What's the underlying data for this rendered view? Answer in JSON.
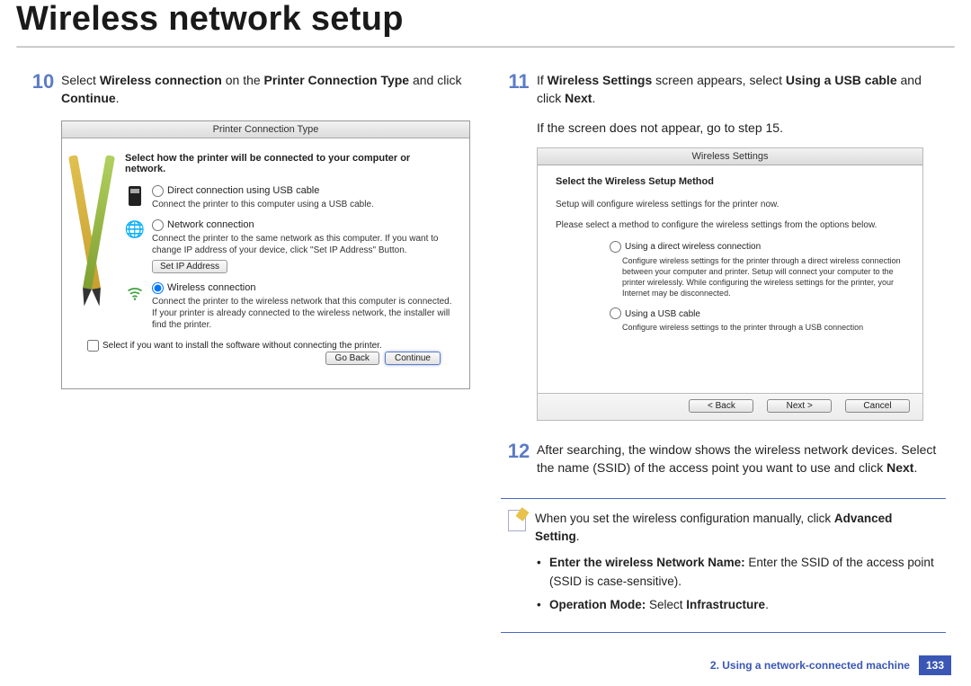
{
  "title": "Wireless network setup",
  "left": {
    "stepNum": "10",
    "stepText": "Select <b>Wireless connection</b> on the <b>Printer Connection Type</b> and click <b>Continue</b>.",
    "dialog": {
      "title": "Printer Connection Type",
      "heading": "Select how the printer will be connected to your computer or network.",
      "opt1_label": "Direct connection using USB cable",
      "opt1_desc": "Connect the printer to this computer using a USB cable.",
      "opt2_label": "Network connection",
      "opt2_desc": "Connect the printer to the same network as this computer.\nIf you want to change IP address of your device, click \"Set IP Address\" Button.",
      "ip_btn": "Set IP Address",
      "opt3_label": "Wireless connection",
      "opt3_desc": "Connect the printer to the wireless network that this computer is connected.\nIf your printer is already connected to the wireless network, the installer will find the printer.",
      "install_chk": "Select if you want to install the software without connecting the printer.",
      "back": "Go Back",
      "cont": "Continue"
    }
  },
  "right": {
    "step11Num": "11",
    "step11Text": "If <b>Wireless Settings</b> screen appears, select <b>Using a USB cable</b> and click <b>Next</b>.",
    "step11Sub": "If the screen does not appear, go to step 15.",
    "dialog2": {
      "title": "Wireless Settings",
      "heading": "Select the Wireless Setup Method",
      "p1": "Setup will configure wireless settings for the printer now.",
      "p2": "Please select a method to configure the wireless settings from the options below.",
      "optA_label": "Using a direct wireless connection",
      "optA_desc": "Configure wireless settings for the printer through a direct wireless connection between your computer and printer. Setup will connect your computer to the printer wirelessly.\nWhile configuring the wireless settings for the printer, your Internet may be disconnected.",
      "optB_label": "Using a USB cable",
      "optB_desc": "Configure wireless settings to the printer through a USB connection",
      "back": "<  Back",
      "next": "Next  >",
      "cancel": "Cancel"
    },
    "step12Num": "12",
    "step12Text": "After searching, the window shows the wireless network devices. Select the name (SSID) of the access point you want to use and click <b>Next</b>.",
    "note": {
      "line1": "When you set the wireless configuration manually, click <b>Advanced Setting</b>.",
      "b1": "<b>Enter the wireless Network Name:</b> Enter the SSID of the access point (SSID is case-sensitive).",
      "b2": "<b>Operation Mode:</b> Select <b>Infrastructure</b>."
    }
  },
  "footer": {
    "chapter": "2.  Using a network-connected machine",
    "page": "133"
  }
}
